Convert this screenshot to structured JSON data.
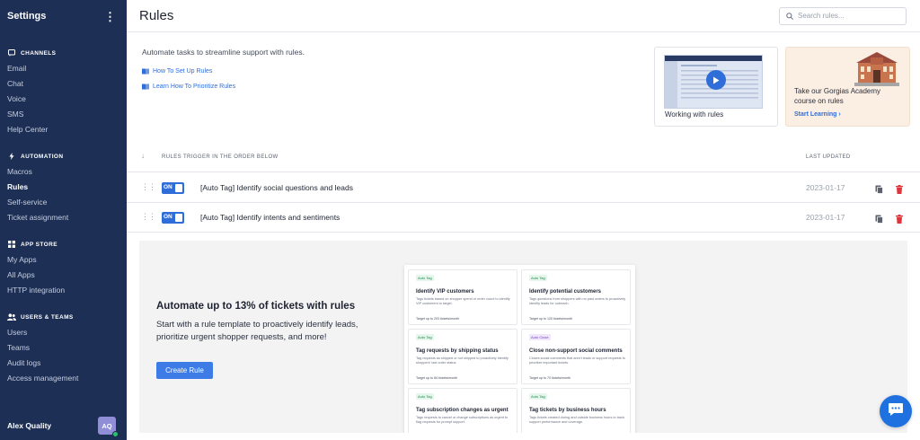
{
  "sidebar": {
    "title": "Settings",
    "sections": [
      {
        "label": "CHANNELS",
        "icon": "channels-icon",
        "items": [
          "Email",
          "Chat",
          "Voice",
          "SMS",
          "Help Center"
        ]
      },
      {
        "label": "AUTOMATION",
        "icon": "bolt-icon",
        "items": [
          "Macros",
          "Rules",
          "Self-service",
          "Ticket assignment"
        ]
      },
      {
        "label": "APP STORE",
        "icon": "grid-icon",
        "items": [
          "My Apps",
          "All Apps",
          "HTTP integration"
        ]
      },
      {
        "label": "USERS & TEAMS",
        "icon": "users-icon",
        "items": [
          "Users",
          "Teams",
          "Audit logs",
          "Access management"
        ]
      }
    ],
    "active_item": "Rules",
    "user": {
      "name": "Alex Quality",
      "initials": "AQ"
    }
  },
  "header": {
    "title": "Rules",
    "search_placeholder": "Search rules..."
  },
  "intro": {
    "text": "Automate tasks to streamline support with rules.",
    "links": [
      "How To Set Up Rules",
      "Learn How To Prioritize Rules"
    ]
  },
  "video_card": {
    "caption": "Working with rules"
  },
  "academy_card": {
    "text": "Take our Gorgias Academy course on rules",
    "link": "Start Learning"
  },
  "list": {
    "header_left": "RULES TRIGGER IN THE ORDER BELOW",
    "header_right": "LAST UPDATED",
    "rows": [
      {
        "toggle": "ON",
        "name": "[Auto Tag] Identify social questions and leads",
        "date": "2023-01-17"
      },
      {
        "toggle": "ON",
        "name": "[Auto Tag] Identify intents and sentiments",
        "date": "2023-01-17"
      }
    ]
  },
  "promo": {
    "title": "Automate up to 13% of tickets with rules",
    "description": "Start with a rule template to proactively identify leads, prioritize urgent shopper requests, and more!",
    "button": "Create Rule",
    "templates": [
      {
        "tag": "Auto Tag",
        "title": "Identify VIP customers",
        "desc": "Tags tickets based on shopper spend or order count to identify VIP customers to target.",
        "footer": "Target up to 203 tickets/month"
      },
      {
        "tag": "Auto Tag",
        "title": "Identify potential customers",
        "desc": "Tags questions from shoppers with no past orders to proactively identify leads for outreach.",
        "footer": "Target up to 120 tickets/month"
      },
      {
        "tag": "Auto Tag",
        "title": "Tag requests by shipping status",
        "desc": "Tag requests as shipped or not shipped to proactively identify shoppers' last order status.",
        "footer": "Target up to 84 tickets/month"
      },
      {
        "tag": "Auto Close",
        "title": "Close non-support social comments",
        "desc": "Closes social comments that aren't leads or support requests to prioritize important tickets.",
        "footer": "Target up to 70 tickets/month"
      },
      {
        "tag": "Auto Tag",
        "title": "Tag subscription changes as urgent",
        "desc": "Tags requests to cancel or change subscriptions as urgent to flag requests for prompt support.",
        "footer": ""
      },
      {
        "tag": "Auto Tag",
        "title": "Tag tickets by business hours",
        "desc": "Tags tickets created during and outside business hours to track support performance and coverage.",
        "footer": ""
      }
    ]
  },
  "colors": {
    "sidebar_bg": "#1d2f55",
    "accent": "#2f6dd9",
    "delete": "#e0333a"
  }
}
